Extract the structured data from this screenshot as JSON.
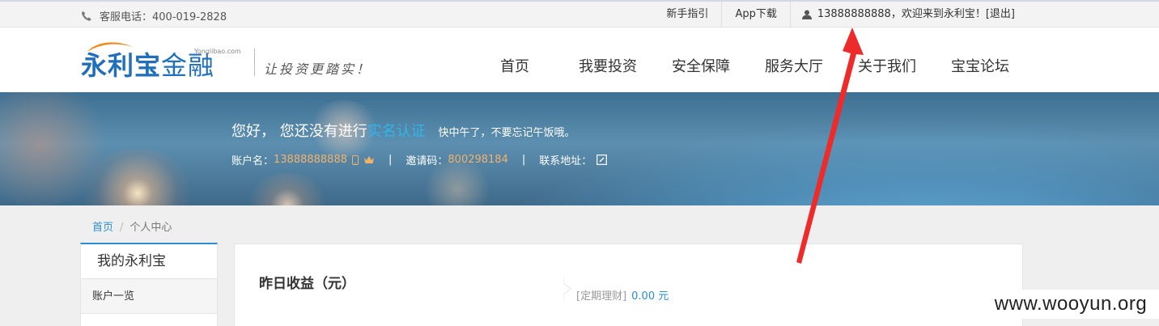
{
  "topbar": {
    "phone_label": "客服电话：400-019-2828",
    "guide": "新手指引",
    "app": "App下载",
    "username": "13888888888",
    "welcome": "，欢迎来到永利宝！",
    "logout": "[退出]"
  },
  "header": {
    "logo_main": "永利宝",
    "logo_fin": "金融",
    "logo_domain": "Yonglibao.com",
    "slogan": "让投资更踏实！",
    "nav": [
      "首页",
      "我要投资",
      "安全保障",
      "服务大厅",
      "关于我们",
      "宝宝论坛"
    ]
  },
  "banner": {
    "greeting": "您好， 您还没有进行",
    "verify_link": "实名认证",
    "noon_tip": "快中午了，不要忘记午饭哦。",
    "account_label": "账户名：",
    "account_value": "13888888888",
    "invite_label": "邀请码：",
    "invite_value": "800298184",
    "address_label": "联系地址：",
    "pipe": "|"
  },
  "breadcrumb": {
    "home": "首页",
    "separator": "/",
    "current": "个人中心"
  },
  "sidebar": {
    "title": "我的永利宝",
    "items": [
      "账户一览"
    ]
  },
  "main": {
    "yesterday_label": "昨日收益（元）",
    "fixed_label": "[定期理财]",
    "fixed_amount": "0.00 元"
  },
  "watermark": "www.wooyun.org",
  "colors": {
    "accent": "#2a8fd0",
    "highlight": "#f3b26a",
    "annotation": "#ee2b2b"
  }
}
